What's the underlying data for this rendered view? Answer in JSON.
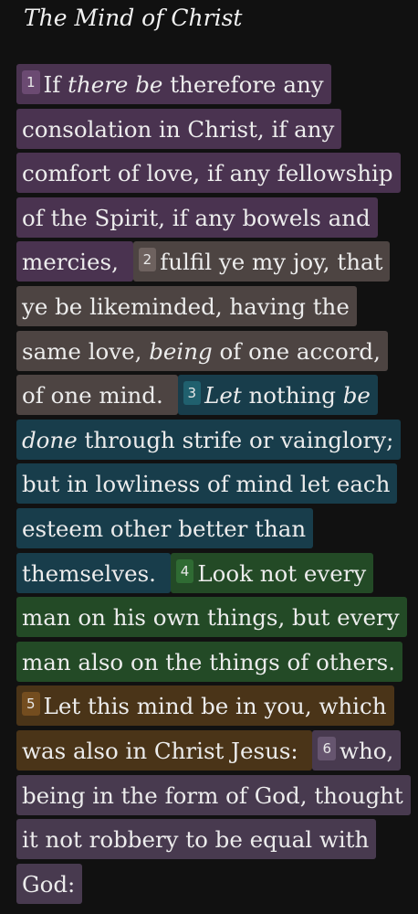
{
  "section": {
    "heading": "The Mind of Christ"
  },
  "verses": [
    {
      "number": "1",
      "lead": "If ",
      "italic_1": "there be",
      "text_1": " therefore any consolation in Christ, if any comfort of love, if any fellowship of the Spirit, if any bowels and mercies, ",
      "highlight_color": "#4a3350",
      "number_color": "#6b4a72"
    },
    {
      "number": "2",
      "text_a": "fulfil ye my joy, that ye be likeminded, having the same love, ",
      "italic_1": "being",
      "text_b": " of one accord, of one mind. ",
      "highlight_color": "#4d4442",
      "number_color": "#6e625f"
    },
    {
      "number": "3",
      "italic_1": "Let",
      "text_a": " nothing ",
      "italic_2": "be done",
      "text_b": " through strife or vainglory; but in lowliness of mind let each esteem other better than themselves. ",
      "highlight_color": "#183d4b",
      "number_color": "#20606e"
    },
    {
      "number": "4",
      "text": "Look not every man on his own things, but every man also on the things of others. ",
      "highlight_color": "#234a26",
      "number_color": "#2f6b33"
    },
    {
      "number": "5",
      "text": "Let this mind be in you, which was also in Christ Jesus: ",
      "highlight_color": "#4a3418",
      "number_color": "#744d1f"
    },
    {
      "number": "6",
      "text": "who, being in the form of God, thought it not robbery to be equal with God:",
      "highlight_color": "#483a4f",
      "number_color": "#66556f"
    }
  ]
}
